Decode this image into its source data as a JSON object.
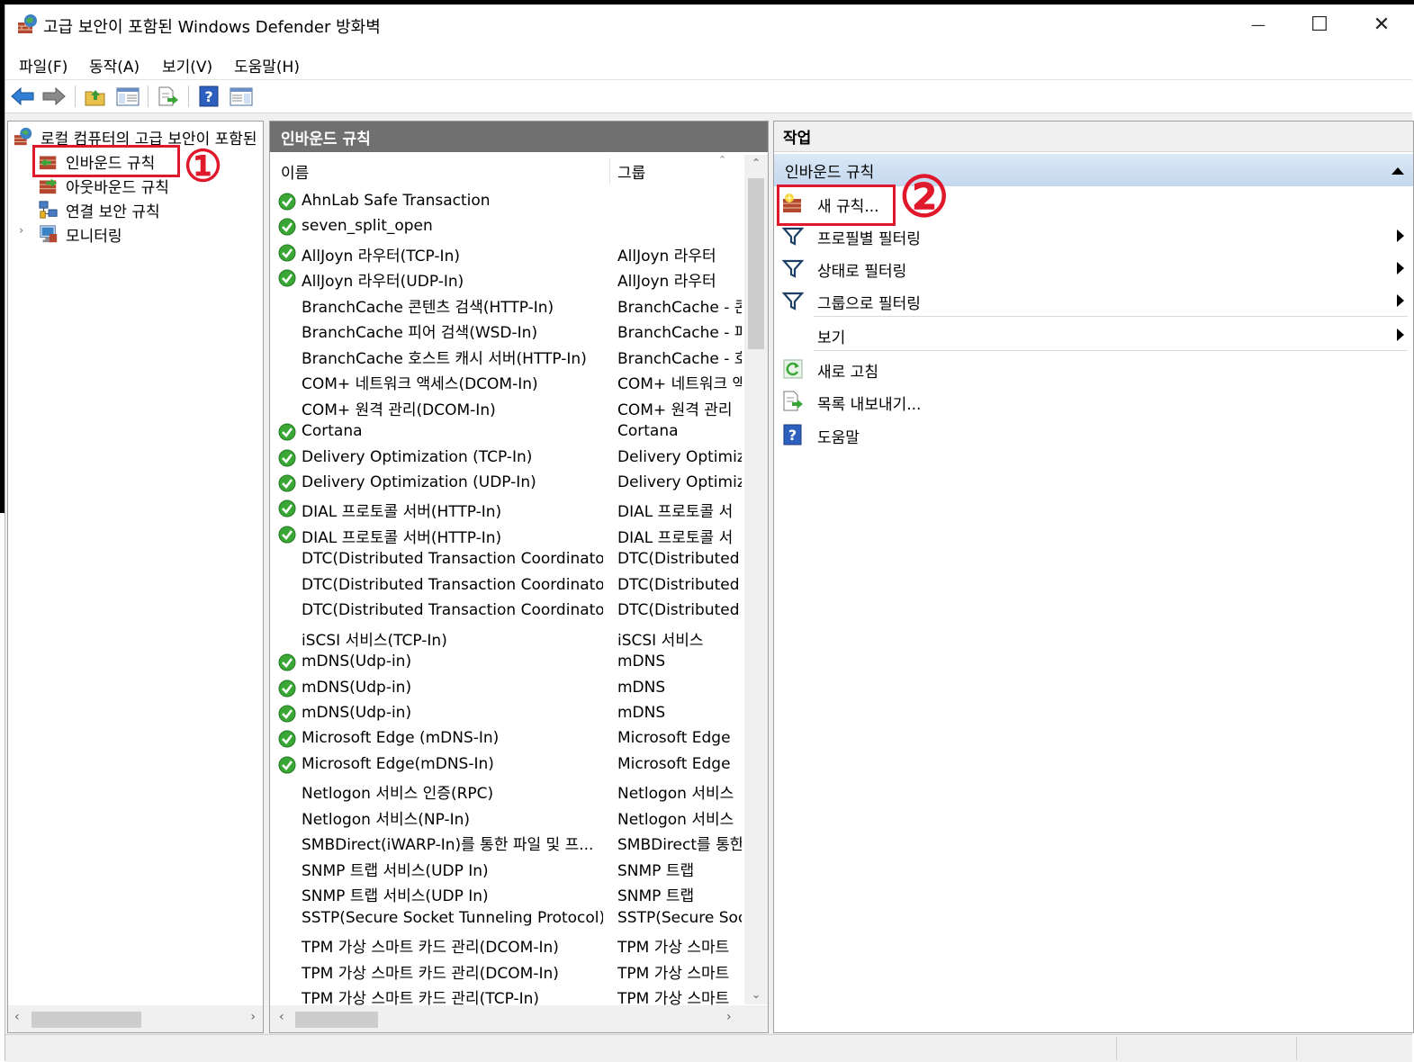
{
  "window": {
    "title": "고급 보안이 포함된 Windows Defender 방화벽",
    "minimize_glyph": "—",
    "maximize_glyph": "☐",
    "close_glyph": "✕"
  },
  "menu": {
    "items": [
      "파일(F)",
      "동작(A)",
      "보기(V)",
      "도움말(H)"
    ]
  },
  "toolbar": {
    "icons": [
      "back-icon",
      "forward-icon",
      "up-folder-icon",
      "show-hide-tree-icon",
      "export-list-icon",
      "help-icon",
      "show-hide-action-pane-icon"
    ]
  },
  "tree": {
    "root": "로컬 컴퓨터의 고급 보안이 포함된",
    "items": [
      {
        "label": "인바운드 규칙",
        "selected": true
      },
      {
        "label": "아웃바운드 규칙"
      },
      {
        "label": "연결 보안 규칙"
      },
      {
        "label": "모니터링",
        "expandable": true
      }
    ]
  },
  "rules": {
    "header": "인바운드 규칙",
    "columns": {
      "name": "이름",
      "group": "그룹"
    },
    "rows": [
      {
        "name": "AhnLab Safe Transaction",
        "group": "",
        "enabled": true
      },
      {
        "name": "seven_split_open",
        "group": "",
        "enabled": true
      },
      {
        "name": "AllJoyn 라우터(TCP-In)",
        "group": "AllJoyn 라우터",
        "enabled": true
      },
      {
        "name": "AllJoyn 라우터(UDP-In)",
        "group": "AllJoyn 라우터",
        "enabled": true
      },
      {
        "name": "BranchCache 콘텐츠 검색(HTTP-In)",
        "group": "BranchCache - 콘",
        "enabled": false
      },
      {
        "name": "BranchCache 피어 검색(WSD-In)",
        "group": "BranchCache - 피",
        "enabled": false
      },
      {
        "name": "BranchCache 호스트 캐시 서버(HTTP-In)",
        "group": "BranchCache - 호",
        "enabled": false
      },
      {
        "name": "COM+ 네트워크 액세스(DCOM-In)",
        "group": "COM+ 네트워크 액",
        "enabled": false
      },
      {
        "name": "COM+ 원격 관리(DCOM-In)",
        "group": "COM+ 원격 관리",
        "enabled": false
      },
      {
        "name": "Cortana",
        "group": "Cortana",
        "enabled": true
      },
      {
        "name": "Delivery Optimization (TCP-In)",
        "group": "Delivery Optimiza",
        "enabled": true
      },
      {
        "name": "Delivery Optimization (UDP-In)",
        "group": "Delivery Optimiza",
        "enabled": true
      },
      {
        "name": "DIAL 프로토콜 서버(HTTP-In)",
        "group": "DIAL 프로토콜 서",
        "enabled": true
      },
      {
        "name": "DIAL 프로토콜 서버(HTTP-In)",
        "group": "DIAL 프로토콜 서",
        "enabled": true
      },
      {
        "name": "DTC(Distributed Transaction Coordinator)...",
        "group": "DTC(Distributed Tr",
        "enabled": false
      },
      {
        "name": "DTC(Distributed Transaction Coordinator)...",
        "group": "DTC(Distributed Tr",
        "enabled": false
      },
      {
        "name": "DTC(Distributed Transaction Coordinator)...",
        "group": "DTC(Distributed Tr",
        "enabled": false
      },
      {
        "name": "iSCSI 서비스(TCP-In)",
        "group": "iSCSI 서비스",
        "enabled": false
      },
      {
        "name": "mDNS(Udp-in)",
        "group": "mDNS",
        "enabled": true
      },
      {
        "name": "mDNS(Udp-in)",
        "group": "mDNS",
        "enabled": true
      },
      {
        "name": "mDNS(Udp-in)",
        "group": "mDNS",
        "enabled": true
      },
      {
        "name": "Microsoft Edge (mDNS-In)",
        "group": "Microsoft Edge",
        "enabled": true
      },
      {
        "name": "Microsoft Edge(mDNS-In)",
        "group": "Microsoft Edge",
        "enabled": true
      },
      {
        "name": "Netlogon 서비스 인증(RPC)",
        "group": "Netlogon 서비스",
        "enabled": false
      },
      {
        "name": "Netlogon 서비스(NP-In)",
        "group": "Netlogon 서비스",
        "enabled": false
      },
      {
        "name": "SMBDirect(iWARP-In)를 통한 파일 및 프...",
        "group": "SMBDirect를 통한",
        "enabled": false
      },
      {
        "name": "SNMP 트랩 서비스(UDP In)",
        "group": "SNMP 트랩",
        "enabled": false
      },
      {
        "name": "SNMP 트랩 서비스(UDP In)",
        "group": "SNMP 트랩",
        "enabled": false
      },
      {
        "name": "SSTP(Secure Socket Tunneling Protocol)(S...",
        "group": "SSTP(Secure Socke",
        "enabled": false
      },
      {
        "name": "TPM 가상 스마트 카드 관리(DCOM-In)",
        "group": "TPM 가상 스마트",
        "enabled": false
      },
      {
        "name": "TPM 가상 스마트 카드 관리(DCOM-In)",
        "group": "TPM 가상 스마트",
        "enabled": false
      },
      {
        "name": "TPM 가상 스마트 카드 관리(TCP-In)",
        "group": "TPM 가상 스마트",
        "enabled": false
      }
    ]
  },
  "actions": {
    "header": "작업",
    "section": "인바운드 규칙",
    "items": [
      {
        "label": "새 규칙...",
        "icon": "new-rule-icon",
        "submenu": false
      },
      {
        "label": "프로필별 필터링",
        "icon": "filter-icon",
        "submenu": true
      },
      {
        "label": "상태로 필터링",
        "icon": "filter-icon",
        "submenu": true
      },
      {
        "label": "그룹으로 필터링",
        "icon": "filter-icon",
        "submenu": true
      },
      {
        "label": "보기",
        "icon": "",
        "submenu": true
      },
      {
        "label": "새로 고침",
        "icon": "refresh-icon",
        "submenu": false
      },
      {
        "label": "목록 내보내기...",
        "icon": "export-list-icon",
        "submenu": false
      },
      {
        "label": "도움말",
        "icon": "help-icon",
        "submenu": false
      }
    ]
  },
  "annotations": {
    "step1": "①",
    "step2": "②"
  },
  "colors": {
    "annotation_red": "#e0182b",
    "pane_header": "#707070",
    "check_green": "#3aa635",
    "section_blue": "#c4d8ee"
  }
}
